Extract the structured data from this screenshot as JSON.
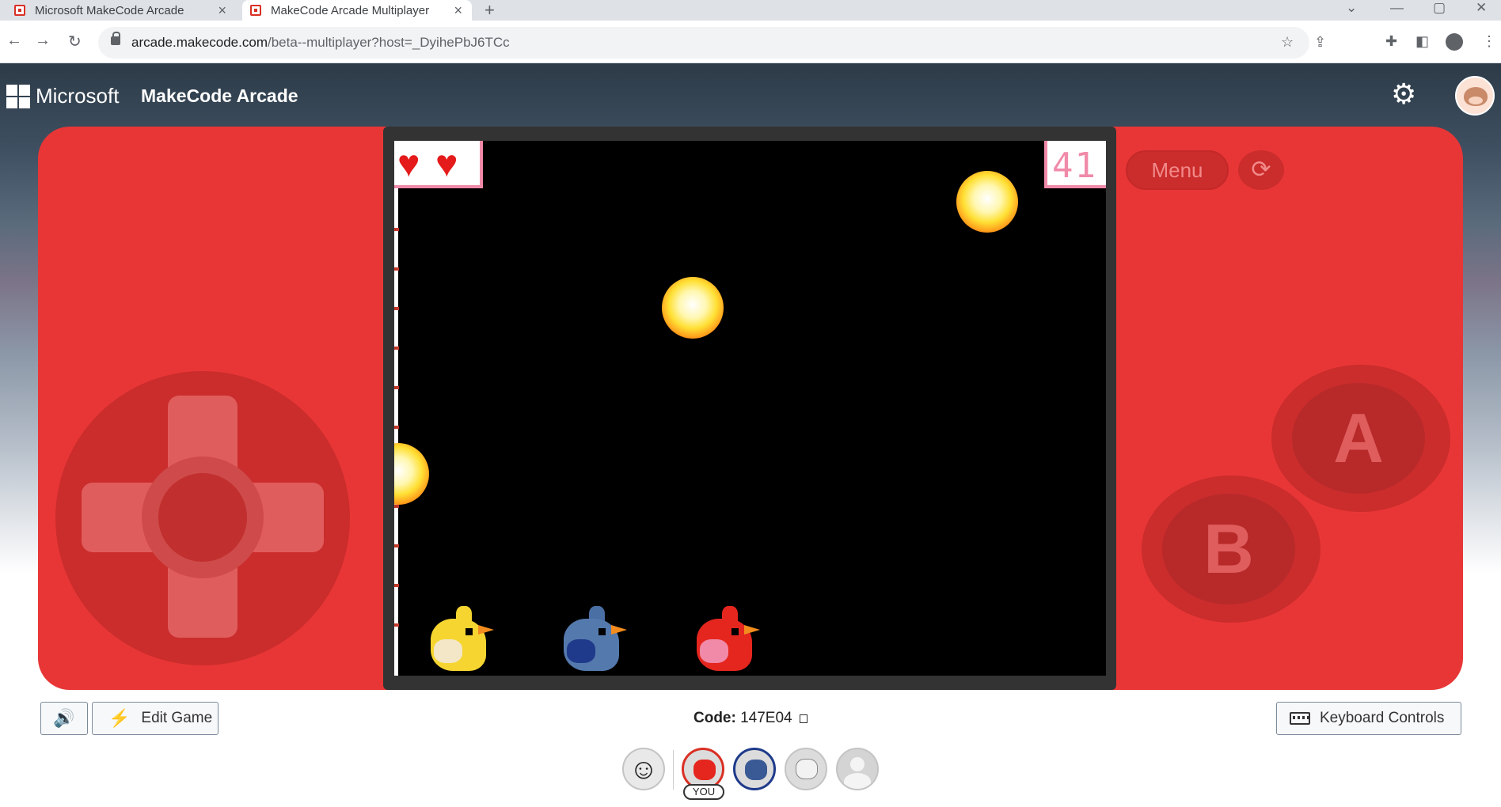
{
  "browser": {
    "tabs": [
      {
        "title": "Microsoft MakeCode Arcade",
        "active": false
      },
      {
        "title": "MakeCode Arcade Multiplayer",
        "active": true
      }
    ],
    "new_tab": "+",
    "url_host": "arcade.makecode.com",
    "url_path": "/beta--multiplayer?host=_DyihePbJ6TCc",
    "icons": [
      "back-icon",
      "forward-icon",
      "reload-icon",
      "lock-icon",
      "share-icon",
      "star-icon",
      "extensions-icon",
      "sidepanel-icon",
      "profile-icon",
      "more-icon"
    ]
  },
  "header": {
    "ms_label": "Microsoft",
    "product": "MakeCode Arcade",
    "icons": [
      "settings-gear-icon",
      "user-avatar"
    ]
  },
  "game": {
    "lives": 2,
    "score": "41",
    "fireballs": 3,
    "players_on_screen": [
      "yellow",
      "blue",
      "red"
    ]
  },
  "console": {
    "menu_label": "Menu",
    "a_label": "A",
    "b_label": "B",
    "colors": {
      "body": "#e83636",
      "screen_frame": "#333333"
    }
  },
  "bottom": {
    "edit_label": "Edit Game",
    "code_label": "Code:",
    "code_value": "147E04",
    "keyboard_label": "Keyboard Controls",
    "you_label": "YOU",
    "player_slots": [
      "player1-red",
      "player2-blue",
      "player3-white",
      "player4-empty"
    ]
  }
}
